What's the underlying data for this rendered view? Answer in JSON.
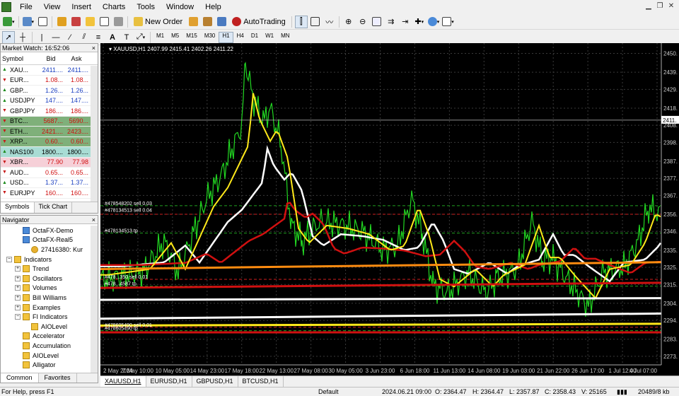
{
  "menu": [
    "File",
    "View",
    "Insert",
    "Charts",
    "Tools",
    "Window",
    "Help"
  ],
  "toolbar": {
    "new_order": "New Order",
    "autotrading": "AutoTrading"
  },
  "timeframes": [
    "M1",
    "M5",
    "M15",
    "M30",
    "H1",
    "H4",
    "D1",
    "W1",
    "MN"
  ],
  "active_timeframe": "H1",
  "market_watch": {
    "title": "Market Watch: 16:52:06",
    "cols": [
      "Symbol",
      "Bid",
      "Ask"
    ],
    "rows": [
      {
        "sym": "XAU...",
        "bid": "2411....",
        "ask": "2411....",
        "dir": "up",
        "bg": "#ffffff",
        "color": "blue"
      },
      {
        "sym": "EUR...",
        "bid": "1.08...",
        "ask": "1.08...",
        "dir": "dn",
        "bg": "#ffffff",
        "color": "red"
      },
      {
        "sym": "GBP...",
        "bid": "1.26...",
        "ask": "1.26...",
        "dir": "up",
        "bg": "#ffffff",
        "color": "blue"
      },
      {
        "sym": "USDJPY",
        "bid": "147....",
        "ask": "147....",
        "dir": "up",
        "bg": "#ffffff",
        "color": "blue"
      },
      {
        "sym": "GBPJPY",
        "bid": "186....",
        "ask": "186....",
        "dir": "dn",
        "bg": "#ffffff",
        "color": "red"
      },
      {
        "sym": "BTC...",
        "bid": "5687...",
        "ask": "5690...",
        "dir": "dn",
        "bg": "#7fb07a",
        "color": "red"
      },
      {
        "sym": "ETH...",
        "bid": "2421....",
        "ask": "2423....",
        "dir": "dn",
        "bg": "#7fb07a",
        "color": "red"
      },
      {
        "sym": "XRP...",
        "bid": "0.60...",
        "ask": "0.60...",
        "dir": "dn",
        "bg": "#7fb07a",
        "color": "red"
      },
      {
        "sym": "NAS100",
        "bid": "1800....",
        "ask": "1800....",
        "dir": "up",
        "bg": "#a8dcd4",
        "color": "black"
      },
      {
        "sym": "XBR...",
        "bid": "77.90",
        "ask": "77.98",
        "dir": "dn",
        "bg": "#f6d0d8",
        "color": "red"
      },
      {
        "sym": "AUD...",
        "bid": "0.65...",
        "ask": "0.65...",
        "dir": "dn",
        "bg": "#ffffff",
        "color": "red"
      },
      {
        "sym": "USD...",
        "bid": "1.37...",
        "ask": "1.37...",
        "dir": "up",
        "bg": "#ffffff",
        "color": "blue"
      },
      {
        "sym": "EURJPY",
        "bid": "160....",
        "ask": "160....",
        "dir": "dn",
        "bg": "#ffffff",
        "color": "red"
      }
    ],
    "tabs": [
      "Symbols",
      "Tick Chart"
    ]
  },
  "navigator": {
    "title": "Navigator",
    "items": [
      {
        "label": "OctaFX-Demo",
        "indent": 1,
        "icon": "server-icon"
      },
      {
        "label": "OctaFX-Real5",
        "indent": 1,
        "icon": "server-icon"
      },
      {
        "label": "27416380: Kur",
        "indent": 2,
        "icon": "account-icon"
      },
      {
        "label": "Indicators",
        "indent": 0,
        "icon": "folder-icon"
      },
      {
        "label": "Trend",
        "indent": 1,
        "icon": "folder-icon"
      },
      {
        "label": "Oscillators",
        "indent": 1,
        "icon": "folder-icon"
      },
      {
        "label": "Volumes",
        "indent": 1,
        "icon": "folder-icon"
      },
      {
        "label": "Bill Williams",
        "indent": 1,
        "icon": "folder-icon"
      },
      {
        "label": "Examples",
        "indent": 1,
        "icon": "folder-icon"
      },
      {
        "label": "FI Indicators",
        "indent": 1,
        "icon": "folder-icon"
      },
      {
        "label": "AIOLevel",
        "indent": 2,
        "icon": "indicator-icon"
      },
      {
        "label": "Accelerator",
        "indent": 1,
        "icon": "indicator-icon"
      },
      {
        "label": "Accumulation",
        "indent": 1,
        "icon": "indicator-icon"
      },
      {
        "label": "AIOLevel",
        "indent": 1,
        "icon": "indicator-icon"
      },
      {
        "label": "Alligator",
        "indent": 1,
        "icon": "indicator-icon"
      }
    ],
    "tabs": [
      "Common",
      "Favorites"
    ]
  },
  "chart": {
    "header": "XAUUSD,H1  2407.99 2415.41 2402.26 2411.22",
    "price_labels": [
      "2450.",
      "2439.",
      "2429.",
      "2418.",
      "2408.",
      "2398.",
      "2387.",
      "2377.",
      "2367.",
      "2356.",
      "2346.",
      "2335.",
      "2325.",
      "2315.",
      "2304.",
      "2294.",
      "2283.",
      "2273."
    ],
    "current_price": "2411.",
    "date_labels": [
      "2 May 2024",
      "7 May 10:00",
      "10 May 05:00",
      "14 May 23:00",
      "17 May 18:00",
      "22 May 13:00",
      "27 May 08:00",
      "30 May 05:00",
      "3 Jun 23:00",
      "6 Jun 18:00",
      "11 Jun 13:00",
      "14 Jun 08:00",
      "19 Jun 03:00",
      "21 Jun 22:00",
      "26 Jun 17:00",
      "1 Jul 12:00",
      "4 Jul 07:00"
    ],
    "order_labels": [
      {
        "text": "#478548202 sell 0.03"
      },
      {
        "text": "#478134513 sell 0.04"
      },
      {
        "text": "#478134513 tp"
      },
      {
        "text": "#478...350 sell 0.01"
      },
      {
        "text": "#478...4587 tp"
      },
      {
        "text": "#478605490 sell 0.01"
      },
      {
        "text": "#478605490 tp"
      }
    ],
    "colors": {
      "price": "#22d822",
      "ma_red": "#d01010",
      "ma_white": "#ffffff",
      "ma_yellow": "#ffe81a",
      "ma_orange": "#ff8c10"
    }
  },
  "chart_tabs": [
    "XAUUSD,H1",
    "EURUSD,H1",
    "GBPUSD,H1",
    "BTCUSD,H1"
  ],
  "status": {
    "help": "For Help, press F1",
    "profile": "Default",
    "datetime": "2024.06.21 09:00",
    "open": "O: 2364.47",
    "high": "H: 2364.47",
    "low": "L: 2357.87",
    "close": "C: 2358.43",
    "volume": "V: 25165",
    "traffic": "20489/8 kb"
  }
}
